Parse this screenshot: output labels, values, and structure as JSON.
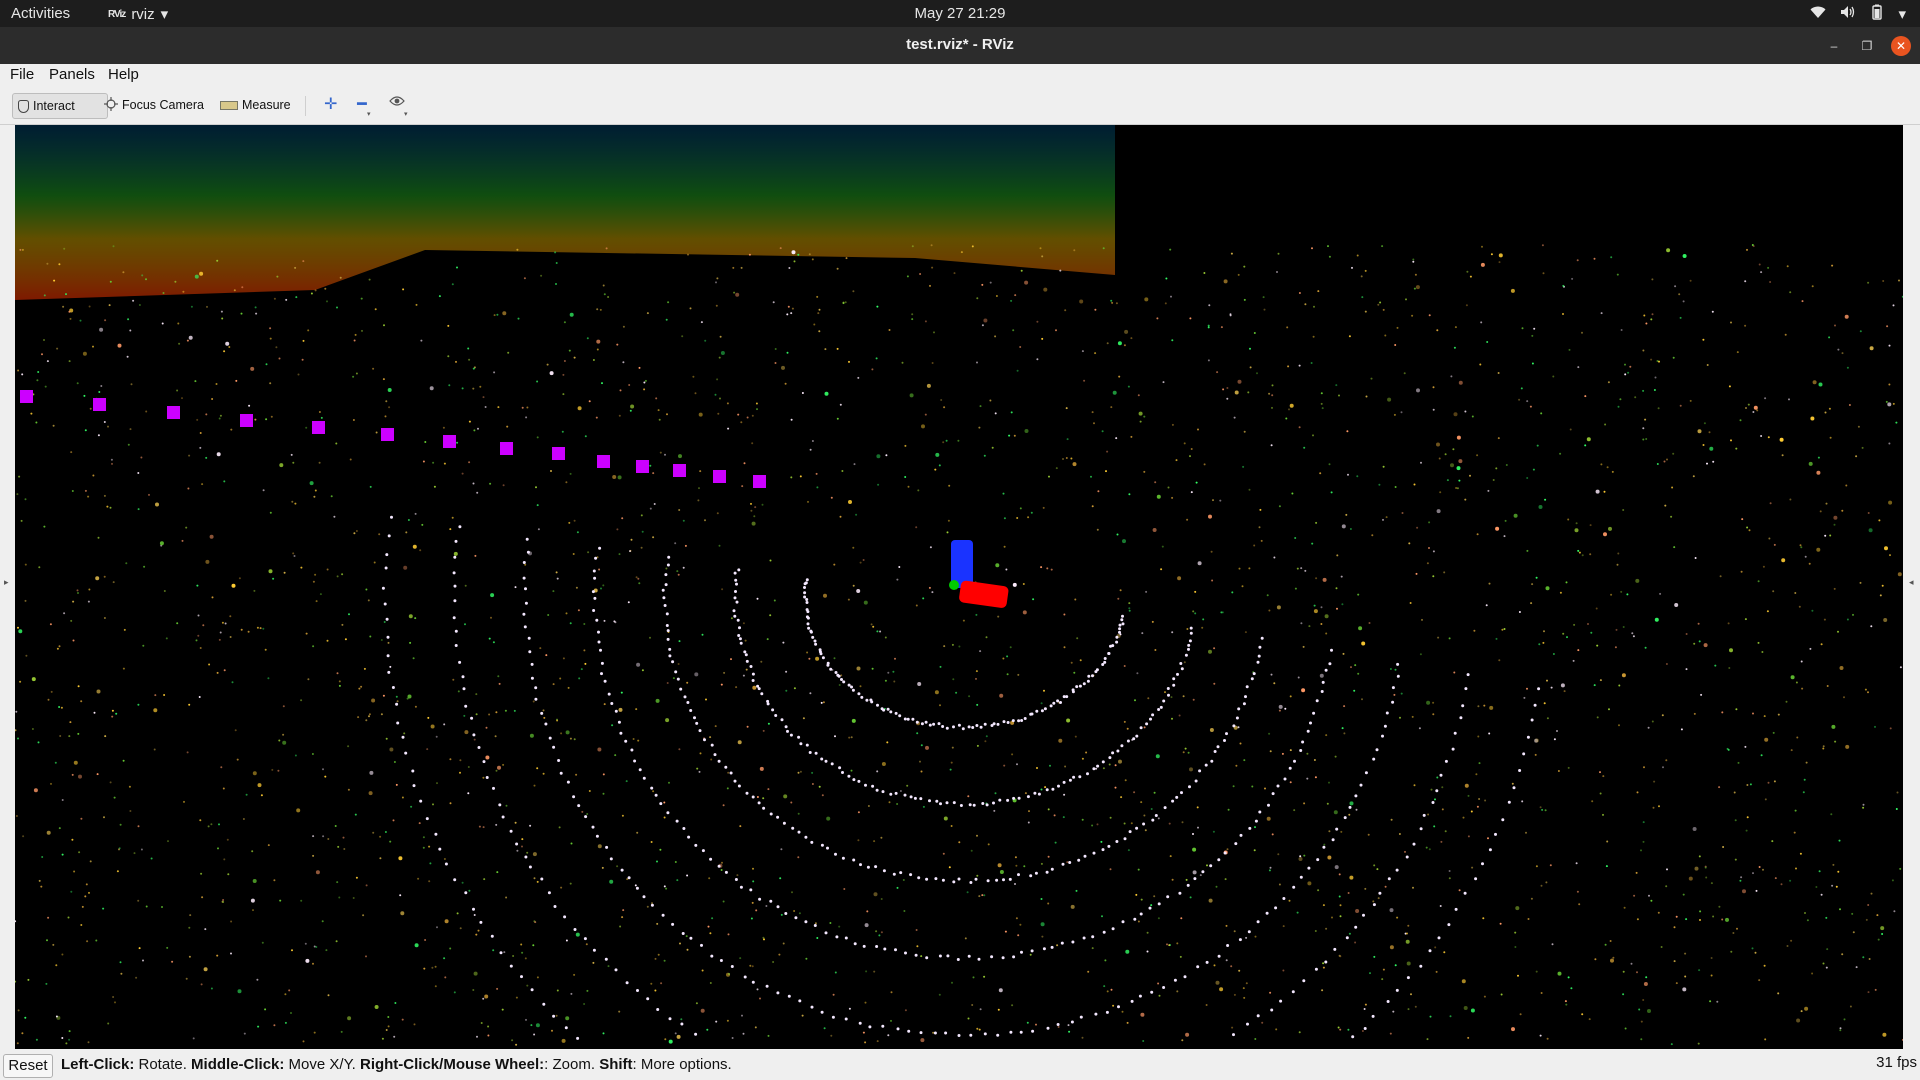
{
  "topbar": {
    "activities": "Activities",
    "app_name": "rviz",
    "app_logo": "RViz",
    "datetime": "May 27  21:29",
    "icons": [
      "wifi-icon",
      "volume-icon",
      "battery-icon",
      "chevron-down-icon"
    ]
  },
  "window": {
    "title": "test.rviz* - RViz"
  },
  "menubar": {
    "items": [
      "File",
      "Panels",
      "Help"
    ]
  },
  "toolbar": {
    "interact": "Interact",
    "focus_camera": "Focus Camera",
    "measure": "Measure",
    "extra_icons": [
      "add-tool-icon",
      "remove-tool-icon",
      "eye-icon"
    ]
  },
  "statusbar": {
    "reset": "Reset",
    "hint": {
      "left_click": "Left-Click:",
      "left_click_action": " Rotate. ",
      "middle_click": "Middle-Click:",
      "middle_click_action": " Move X/Y. ",
      "right_click": "Right-Click/Mouse Wheel:",
      "right_click_action": ": Zoom. ",
      "shift": "Shift",
      "shift_action": ": More options."
    },
    "fps": "31 fps"
  },
  "scene": {
    "background": "#000000",
    "path_marker_color": "#cc00ff",
    "axis_colors": {
      "x": "#ff0000",
      "y": "#00cc00",
      "z": "#1a33ff"
    },
    "point_color_low": "#ff3300",
    "point_color_high": "#0099ff"
  }
}
